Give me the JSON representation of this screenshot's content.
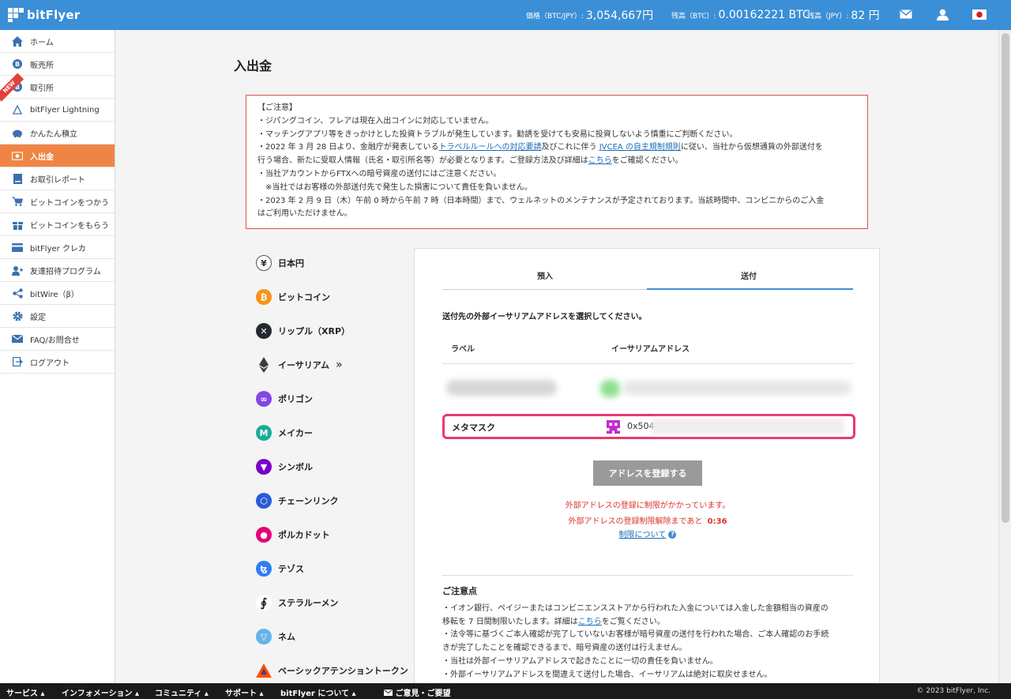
{
  "header": {
    "brand": "bitFlyer",
    "price_label": "価格（BTC/JPY）:",
    "price_value": "3,054,667円",
    "btc_balance_label": "残高（BTC）:",
    "btc_balance_value": "0.00162221 BTC",
    "jpy_balance_label": "残高（JPY）:",
    "jpy_balance_value": "82 円",
    "icons": [
      "mail-icon",
      "user-icon",
      "japan-flag-icon"
    ]
  },
  "sidebar": {
    "new_badge": "NEW",
    "items": [
      {
        "label": "ホーム",
        "icon": "home-icon"
      },
      {
        "label": "販売所",
        "icon": "bitcoin-icon"
      },
      {
        "label": "取引所",
        "icon": "bitcoin-icon"
      },
      {
        "label": "bitFlyer Lightning",
        "icon": "lightning-icon"
      },
      {
        "label": "かんたん積立",
        "icon": "piggy-bank-icon"
      },
      {
        "label": "入出金",
        "icon": "money-icon",
        "active": true
      },
      {
        "label": "お取引レポート",
        "icon": "report-icon"
      },
      {
        "label": "ビットコインをつかう",
        "icon": "cart-icon"
      },
      {
        "label": "ビットコインをもらう",
        "icon": "gift-icon"
      },
      {
        "label": "bitFlyer クレカ",
        "icon": "card-icon"
      },
      {
        "label": "友達招待プログラム",
        "icon": "invite-icon"
      },
      {
        "label": "bitWire（β）",
        "icon": "share-icon"
      },
      {
        "label": "設定",
        "icon": "gear-icon"
      },
      {
        "label": "FAQ/お問合せ",
        "icon": "mail-icon"
      },
      {
        "label": "ログアウト",
        "icon": "logout-icon"
      }
    ]
  },
  "page": {
    "title": "入出金",
    "notice": {
      "l1": "【ご注意】",
      "l2": "・ジパングコイン、フレアは現在入出コインに対応していません。",
      "l3": "・マッチングアプリ等をきっかけとした投資トラブルが発生しています。勧誘を受けても安易に投資しないよう慎重にご判断ください。",
      "l4a": "・2022 年 3 月 28 日より、金融庁が発表している",
      "l4link1": "トラベルルールへの対応要請",
      "l4b": "及びこれに伴う ",
      "l4link2": "JVCEA の自主規制規則",
      "l4c": "に従い、当社から仮想通貨の外部送付を",
      "l5a": "行う場合、新たに受取人情報（氏名・取引所名等）が必要となります。ご登録方法及び詳細は",
      "l5link": "こちら",
      "l5b": "をご確認ください。",
      "l6": "・当社アカウントからFTXへの暗号資産の送付にはご注意ください。",
      "l7": "　※当社ではお客様の外部送付先で発生した損害について責任を負いません。",
      "l8": "・2023 年 2 月 9 日（木）午前 0 時から午前 7 時（日本時間）まで、ウェルネットのメンテナンスが予定されております。当該時間中、コンビニからのご入金",
      "l9": "はご利用いただけません。"
    },
    "coins": [
      {
        "label": "日本円",
        "icon": "yen-icon",
        "color": "#ffffff"
      },
      {
        "label": "ビットコイン",
        "icon": "bitcoin-icon",
        "color": "#f7931a"
      },
      {
        "label": "リップル（XRP）",
        "icon": "xrp-icon",
        "color": "#23292f"
      },
      {
        "label": "イーサリアム",
        "icon": "ethereum-icon",
        "color": "#3c3c3d",
        "suffix": "»"
      },
      {
        "label": "ポリゴン",
        "icon": "polygon-icon",
        "color": "#8247e5"
      },
      {
        "label": "メイカー",
        "icon": "maker-icon",
        "color": "#1aab9b"
      },
      {
        "label": "シンボル",
        "icon": "symbol-icon",
        "color": "#7a00c9"
      },
      {
        "label": "チェーンリンク",
        "icon": "chainlink-icon",
        "color": "#2a5ada"
      },
      {
        "label": "ポルカドット",
        "icon": "polkadot-icon",
        "color": "#e6007a"
      },
      {
        "label": "テゾス",
        "icon": "tezos-icon",
        "color": "#2c7df7"
      },
      {
        "label": "ステラルーメン",
        "icon": "stellar-icon",
        "color": "#ffffff"
      },
      {
        "label": "ネム",
        "icon": "nem-icon",
        "color": "#67b2e8"
      },
      {
        "label": "ベーシックアテンショントークン",
        "icon": "bat-icon",
        "color": "#ff5000"
      }
    ],
    "panel": {
      "tab_deposit": "預入",
      "tab_send": "送付",
      "heading": "送付先の外部イーサリアムアドレスを選択してください。",
      "col_label": "ラベル",
      "col_address": "イーサリアムアドレス",
      "selected_row": {
        "label": "メタマスク",
        "address": "0x504"
      },
      "register_button": "アドレスを登録する",
      "warning1": "外部アドレスの登録に制限がかかっています。",
      "warning2": "外部アドレスの登録制限解除まであと",
      "countdown": "0:36",
      "limit_link": "制限について",
      "help_glyph": "?",
      "cautions_title": "ご注意点",
      "c1": "・イオン銀行、ペイジーまたはコンビニエンスストアから行われた入金については入金した金額相当の資産の",
      "c2a": "移転を 7 日間制限いたします。詳細は",
      "c2link": "こちら",
      "c2b": "をご覧ください。",
      "c3": "・法令等に基づくご本人確認が完了していないお客様が暗号資産の送付を行われた場合、ご本人確認のお手続",
      "c4": "きが完了したことを確認できるまで、暗号資産の送付は行えません。",
      "c5": "・当社は外部イーサリアムアドレスで起きたことに一切の責任を負いません。",
      "c6": "・外部イーサリアムアドレスを間違えて送付した場合、イーサリアムは絶対に取戻せません。"
    }
  },
  "footer": {
    "items": [
      "サービス ▴",
      "インフォメーション ▴",
      "コミュニティ ▴",
      "サポート ▴",
      "bitFlyer について ▴"
    ],
    "feedback": "ご意見・ご要望",
    "copyright": "© 2023 bitFlyer, Inc."
  }
}
